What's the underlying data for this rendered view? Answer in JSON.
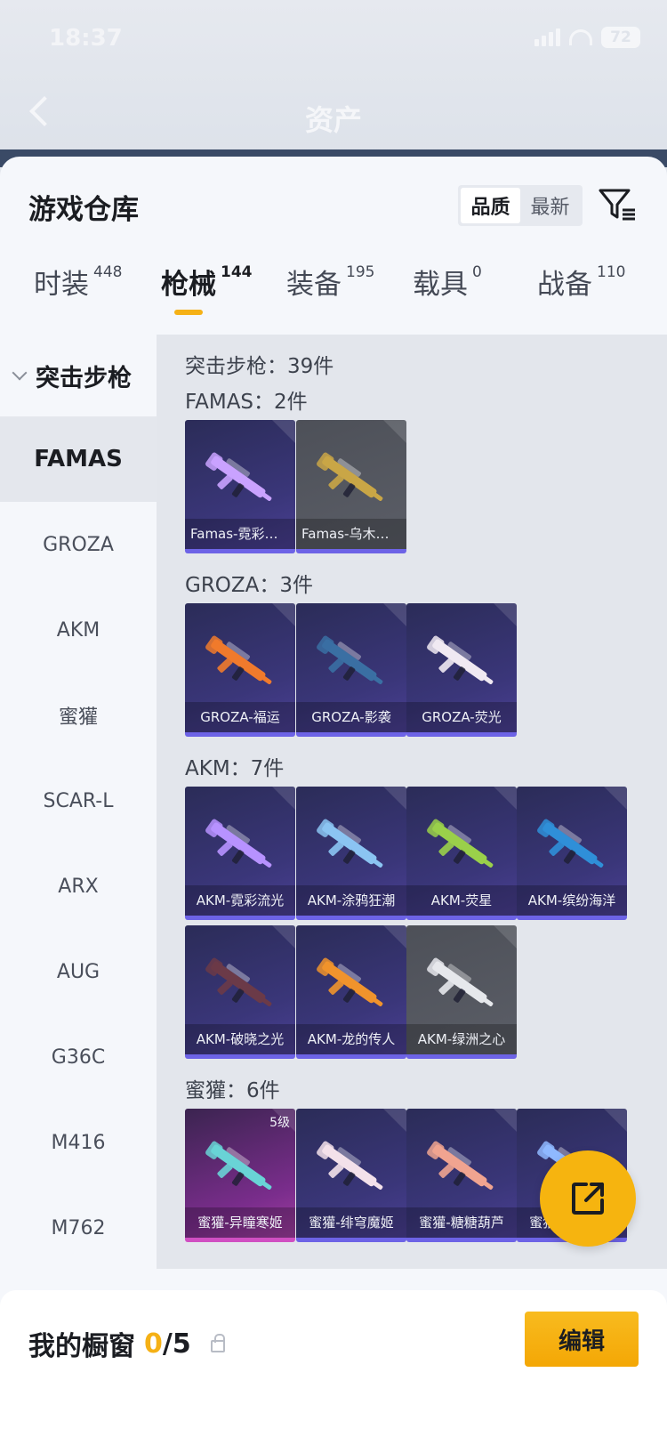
{
  "status": {
    "time": "18:37",
    "battery": "72"
  },
  "header": {
    "title": "资产"
  },
  "sheet": {
    "title": "游戏仓库",
    "sort": {
      "quality": "品质",
      "newest": "最新"
    }
  },
  "tabs": [
    {
      "label": "时装",
      "count": "448"
    },
    {
      "label": "枪械",
      "count": "144"
    },
    {
      "label": "装备",
      "count": "195"
    },
    {
      "label": "载具",
      "count": "0"
    },
    {
      "label": "战备",
      "count": "110"
    }
  ],
  "sidebar": {
    "header": "突击步枪",
    "items": [
      "FAMAS",
      "GROZA",
      "AKM",
      "蜜獾",
      "SCAR-L",
      "ARX",
      "AUG",
      "G36C",
      "M416",
      "M762"
    ]
  },
  "content": {
    "summary": "突击步枪：39件",
    "sections": [
      {
        "title": "FAMAS：2件",
        "items": [
          {
            "label": "Famas-霓彩流光",
            "bg": "purple",
            "gun": "#c9a2ff"
          },
          {
            "label": "Famas-乌木金辉",
            "bg": "grey",
            "gun": "#c9a646"
          }
        ]
      },
      {
        "title": "GROZA：3件",
        "items": [
          {
            "label": "GROZA-福运",
            "bg": "purple",
            "gun": "#f07a2c"
          },
          {
            "label": "GROZA-影袭",
            "bg": "purple",
            "gun": "#3a6fa3"
          },
          {
            "label": "GROZA-荧光",
            "bg": "purple",
            "gun": "#f0e9f2"
          }
        ]
      },
      {
        "title": "AKM：7件",
        "items": [
          {
            "label": "AKM-霓彩流光",
            "bg": "purple",
            "gun": "#b792ff"
          },
          {
            "label": "AKM-涂鸦狂潮",
            "bg": "purple",
            "gun": "#8bc4f2"
          },
          {
            "label": "AKM-荧星",
            "bg": "purple",
            "gun": "#9ad04a"
          },
          {
            "label": "AKM-缤纷海洋",
            "bg": "purple",
            "gun": "#2f8fd8"
          },
          {
            "label": "AKM-破晓之光",
            "bg": "purple",
            "gun": "#6b3a48"
          },
          {
            "label": "AKM-龙的传人",
            "bg": "purple",
            "gun": "#f0932c"
          },
          {
            "label": "AKM-绿洲之心",
            "bg": "grey",
            "gun": "#e6e8ec"
          }
        ]
      },
      {
        "title": "蜜獾：6件",
        "items": [
          {
            "label": "蜜獾-异瞳寒姬",
            "bg": "pink",
            "gun": "#69d3d6",
            "level": "5级"
          },
          {
            "label": "蜜獾-绯穹魔姬",
            "bg": "purple",
            "gun": "#f3e1ea"
          },
          {
            "label": "蜜獾-糖糖葫芦",
            "bg": "purple",
            "gun": "#f0a490"
          },
          {
            "label": "蜜獾-精灵梦境",
            "bg": "purple",
            "gun": "#8fb9ff"
          }
        ]
      }
    ]
  },
  "showcase": {
    "label": "我的橱窗",
    "current": "0",
    "total": "/5"
  },
  "edit_button": "编辑",
  "colors": {
    "accent": "#f5b116",
    "card_border": "#6d63e6"
  }
}
